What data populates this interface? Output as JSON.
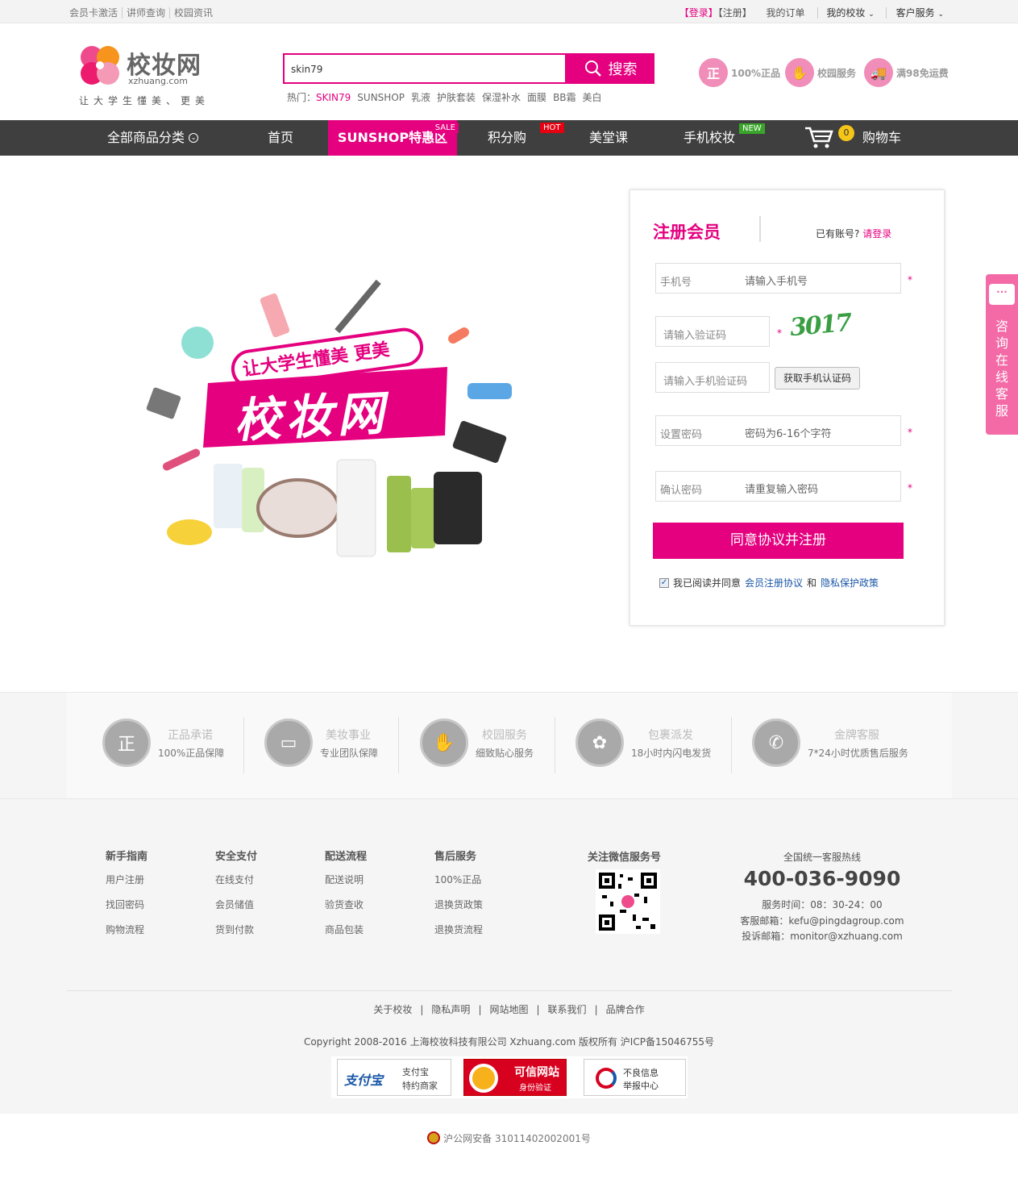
{
  "topbar": {
    "left": [
      "会员卡激活",
      "讲师查询",
      "校园资讯"
    ],
    "login": "【登录】",
    "register": "【注册】",
    "orders": "我的订单",
    "my_xz": "我的校妆",
    "service": "客户服务"
  },
  "logo": {
    "name": "校妆网",
    "domain": "xzhuang.com",
    "slogan": "让大学生懂美、更美"
  },
  "search": {
    "value": "skin79",
    "button": "搜索"
  },
  "hot": {
    "label": "热门：",
    "items": [
      "SKIN79",
      "SUNSHOP",
      "乳液",
      "护肤套装",
      "保湿补水",
      "面膜",
      "BB霜",
      "美白"
    ]
  },
  "promises": [
    {
      "icon": "正",
      "label": "100%正品"
    },
    {
      "icon": "hands",
      "label": "校园服务"
    },
    {
      "icon": "truck",
      "label": "满98免运费"
    }
  ],
  "nav": {
    "all": "全部商品分类",
    "home": "首页",
    "sunshop": "SUNSHOP特惠区",
    "sale_tag": "SALE",
    "points": "积分购",
    "hot_tag": "HOT",
    "class": "美堂课",
    "mobile": "手机校妆",
    "new_tag": "NEW",
    "cart_count": "0",
    "cart": "购物车"
  },
  "banner": {
    "tagline": "让大学生懂美 更美",
    "title": "校妆网"
  },
  "register": {
    "title": "注册会员",
    "has_account": "已有账号?",
    "login_link": "请登录",
    "phone_label": "手机号",
    "phone_ph": "请输入手机号",
    "captcha_ph": "请输入验证码",
    "captcha_img": "3017",
    "sms_ph": "请输入手机验证码",
    "sms_btn": "获取手机认证码",
    "pwd_label": "设置密码",
    "pwd_ph": "密码为6-16个字符",
    "pwd2_label": "确认密码",
    "pwd2_ph": "请重复输入密码",
    "submit": "同意协议并注册",
    "agree_text": "我已阅读并同意",
    "agreement": "会员注册协议",
    "and": "和",
    "privacy": "隐私保护政策",
    "star": "*"
  },
  "side": {
    "text": "咨询在线客服"
  },
  "services": [
    {
      "icon": "正",
      "title": "正品承诺",
      "desc": "100%正品保障"
    },
    {
      "icon": "box",
      "title": "美妆事业",
      "desc": "专业团队保障"
    },
    {
      "icon": "hands",
      "title": "校园服务",
      "desc": "细致贴心服务"
    },
    {
      "icon": "gift",
      "title": "包裹派发",
      "desc": "18小时内闪电发货"
    },
    {
      "icon": "phone",
      "title": "金牌客服",
      "desc": "7*24小时优质售后服务"
    }
  ],
  "footer": {
    "cols": [
      {
        "title": "新手指南",
        "items": [
          "用户注册",
          "找回密码",
          "购物流程"
        ]
      },
      {
        "title": "安全支付",
        "items": [
          "在线支付",
          "会员储值",
          "货到付款"
        ]
      },
      {
        "title": "配送流程",
        "items": [
          "配送说明",
          "验货查收",
          "商品包装"
        ]
      },
      {
        "title": "售后服务",
        "items": [
          "100%正品",
          "退换货政策",
          "退换货流程"
        ]
      }
    ],
    "wechat": "关注微信服务号",
    "hotline_label": "全国统一客服热线",
    "hotline": "400-036-9090",
    "hours": "服务时间：08：30-24：00",
    "email": "客服邮箱：kefu@pingdagroup.com",
    "complaint": "投诉邮箱：monitor@xzhuang.com",
    "links": [
      "关于校妆",
      "隐私声明",
      "网站地图",
      "联系我们",
      "品牌合作"
    ],
    "copyright": "Copyright 2008-2016 上海校妆科技有限公司 Xzhuang.com 版权所有 沪ICP备15046755号",
    "badges": {
      "alipay_logo": "支付宝",
      "alipay_l1": "支付宝",
      "alipay_l2": "特约商家",
      "trust_l1": "可信网站",
      "trust_l2": "身份验证",
      "report_l1": "不良信息",
      "report_l2": "举报中心"
    },
    "police": "沪公网安备 31011402002001号"
  }
}
